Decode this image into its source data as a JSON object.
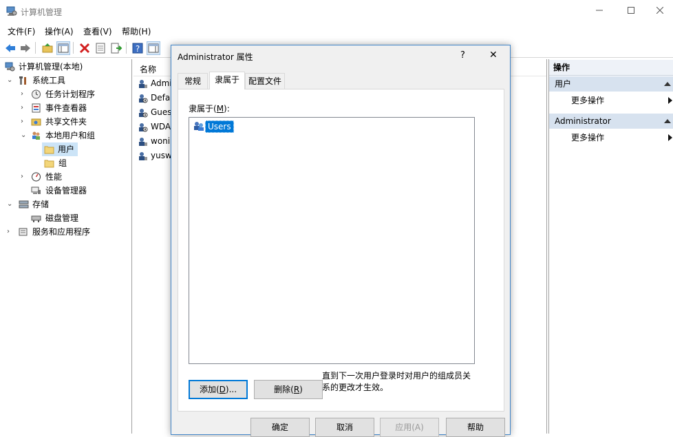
{
  "window": {
    "title": "计算机管理",
    "minimize_icon": "minimize-icon",
    "maximize_icon": "maximize-icon",
    "close_icon": "close-icon"
  },
  "menubar": {
    "items": [
      "文件(F)",
      "操作(A)",
      "查看(V)",
      "帮助(H)"
    ]
  },
  "toolbar": {
    "icons": [
      "back-arrow-icon",
      "forward-arrow-icon",
      "up-folder-icon",
      "show-hide-tree-icon",
      "delete-icon",
      "properties-icon",
      "export-icon",
      "help-icon",
      "show-hide-action-pane-icon"
    ]
  },
  "tree": {
    "root": "计算机管理(本地)",
    "system_tools": "系统工具",
    "task_scheduler": "任务计划程序",
    "event_viewer": "事件查看器",
    "shared_folders": "共享文件夹",
    "local_users_groups": "本地用户和组",
    "users": "用户",
    "groups": "组",
    "performance": "性能",
    "device_manager": "设备管理器",
    "storage": "存储",
    "disk_management": "磁盘管理",
    "services_apps": "服务和应用程序"
  },
  "list": {
    "column_name": "名称",
    "items": [
      "Admi",
      "Defa",
      "Gues",
      "WDA",
      "wonir",
      "yusw"
    ]
  },
  "actions": {
    "header": "操作",
    "section1": "用户",
    "section1_more": "更多操作",
    "section2": "Administrator",
    "section2_more": "更多操作"
  },
  "dialog": {
    "title": "Administrator 属性",
    "help_glyph": "?",
    "close_glyph": "✕",
    "tabs": [
      "常规",
      "隶属于",
      "配置文件"
    ],
    "active_tab": "隶属于",
    "member_of_label": "隶属于(",
    "member_of_key": "M",
    "member_of_suffix": "):",
    "members": [
      "Users"
    ],
    "add_button_prefix": "添加(",
    "add_button_key": "D",
    "add_button_suffix": ")...",
    "remove_button_prefix": "删除(",
    "remove_button_key": "R",
    "remove_button_suffix": ")",
    "note": "直到下一次用户登录时对用户的组成员关系的更改才生效。",
    "note_line1": "直到下一次用户登录时对用户的组成员关",
    "note_line2": "系的更改才生效。",
    "ok": "确定",
    "cancel": "取消",
    "apply": "应用(A)",
    "help": "帮助"
  },
  "colors": {
    "accent": "#0078d7",
    "selection": "#0078d7",
    "action_section": "#d7e2ef"
  }
}
